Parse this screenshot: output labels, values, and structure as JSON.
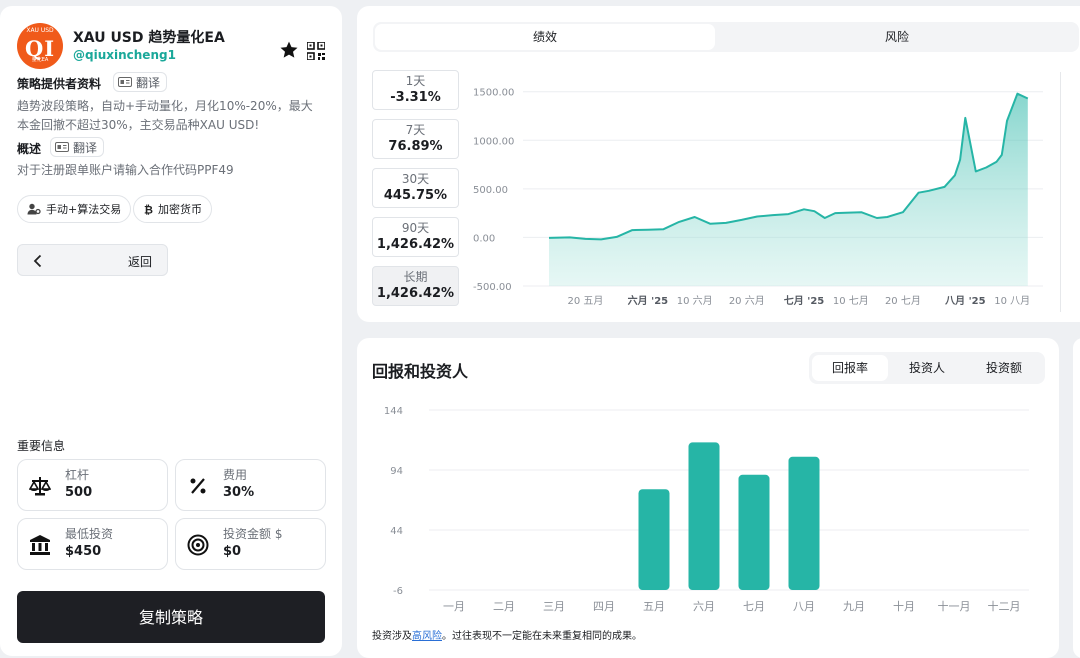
{
  "profile": {
    "avatar_text": "QI",
    "avatar_top": "XAU USD",
    "avatar_sub": "量化EA",
    "title": "XAU USD 趋势量化EA",
    "handle": "@qiuxincheng1"
  },
  "sections": {
    "provider_label": "策略提供者资料",
    "translate_label": "翻译",
    "provider_desc": "趋势波段策略，自动+手动量化，月化10%-20%，最大本金回撤不超过30%，主交易品种XAU USD!",
    "overview_label": "概述",
    "overview_desc": "对于注册跟单账户请输入合作代码PPF49"
  },
  "tags": [
    "手动+算法交易",
    "加密货币"
  ],
  "back_label": "返回",
  "important": {
    "title": "重要信息",
    "items": [
      {
        "label": "杠杆",
        "value": "500",
        "icon": "scale-icon"
      },
      {
        "label": "费用",
        "value": "30%",
        "icon": "percent-icon"
      },
      {
        "label": "最低投资",
        "value": "$450",
        "icon": "bank-icon"
      },
      {
        "label": "投资金额 $",
        "value": "$0",
        "icon": "target-icon"
      }
    ]
  },
  "copy_button": "复制策略",
  "perf_tabs": [
    "绩效",
    "风险"
  ],
  "periods": [
    {
      "label": "1天",
      "value": "-3.31%"
    },
    {
      "label": "7天",
      "value": "76.89%"
    },
    {
      "label": "30天",
      "value": "445.75%"
    },
    {
      "label": "90天",
      "value": "1,426.42%"
    },
    {
      "label": "长期",
      "value": "1,426.42%"
    }
  ],
  "returns": {
    "title": "回报和投资人",
    "tabs": [
      "回报率",
      "投资人",
      "投资额"
    ],
    "disclaimer_pre": "投资涉及",
    "disclaimer_link": "高风险",
    "disclaimer_post": "。过往表现不一定能在未来重复相同的成果。"
  },
  "colors": {
    "accent": "#26b5a6",
    "fill": "#b8e8e1",
    "dark": "#1e1f24"
  },
  "chart_data": [
    {
      "type": "area",
      "x_dates": [
        "2025-05-13",
        "2025-05-17",
        "2025-05-20",
        "2025-05-23",
        "2025-05-26",
        "2025-05-29",
        "2025-06-01",
        "2025-06-04",
        "2025-06-07",
        "2025-06-10",
        "2025-06-13",
        "2025-06-16",
        "2025-06-19",
        "2025-06-22",
        "2025-06-25",
        "2025-06-28",
        "2025-07-01",
        "2025-07-03",
        "2025-07-05",
        "2025-07-07",
        "2025-07-09",
        "2025-07-12",
        "2025-07-15",
        "2025-07-17",
        "2025-07-20",
        "2025-07-23",
        "2025-07-25",
        "2025-07-28",
        "2025-07-30",
        "2025-07-31",
        "2025-08-01",
        "2025-08-03",
        "2025-08-05",
        "2025-08-07",
        "2025-08-08",
        "2025-08-09",
        "2025-08-11",
        "2025-08-13"
      ],
      "values": [
        -5,
        0,
        -15,
        -20,
        5,
        75,
        80,
        85,
        160,
        210,
        140,
        150,
        180,
        215,
        230,
        240,
        290,
        270,
        200,
        250,
        255,
        260,
        200,
        210,
        260,
        460,
        480,
        520,
        640,
        800,
        1230,
        680,
        720,
        780,
        850,
        1200,
        1480,
        1430
      ],
      "ylim": [
        -500,
        1600
      ],
      "y_ticks": [
        "1500.00",
        "1000.00",
        "500.00",
        "0.00",
        "-500.00"
      ],
      "x_labels": [
        {
          "date": "2025-05-20",
          "text": "20 五月",
          "bold": false
        },
        {
          "date": "2025-06-01",
          "text": "六月 '25",
          "bold": true
        },
        {
          "date": "2025-06-10",
          "text": "10 六月",
          "bold": false
        },
        {
          "date": "2025-06-20",
          "text": "20 六月",
          "bold": false
        },
        {
          "date": "2025-07-01",
          "text": "七月 '25",
          "bold": true
        },
        {
          "date": "2025-07-10",
          "text": "10 七月",
          "bold": false
        },
        {
          "date": "2025-07-20",
          "text": "20 七月",
          "bold": false
        },
        {
          "date": "2025-08-01",
          "text": "八月 '25",
          "bold": true
        },
        {
          "date": "2025-08-10",
          "text": "10 八月",
          "bold": false
        }
      ],
      "grid": true
    },
    {
      "type": "bar",
      "categories": [
        "一月",
        "二月",
        "三月",
        "四月",
        "五月",
        "六月",
        "七月",
        "八月",
        "九月",
        "十月",
        "十一月",
        "十二月"
      ],
      "values": [
        null,
        null,
        null,
        null,
        78,
        117,
        90,
        105,
        null,
        null,
        null,
        null
      ],
      "ylim": [
        -6,
        144
      ],
      "y_ticks": [
        "144",
        "94",
        "44",
        "-6"
      ],
      "grid": true
    }
  ]
}
